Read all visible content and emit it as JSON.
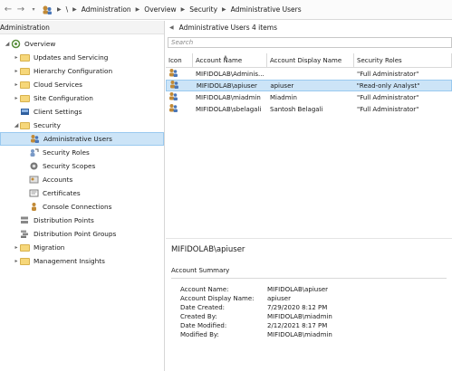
{
  "breadcrumb": {
    "items": [
      "Administration",
      "Overview",
      "Security",
      "Administrative Users"
    ]
  },
  "left_pane": {
    "title": "Administration",
    "items": [
      {
        "label": "Overview",
        "indent": 0,
        "arrow": "◢",
        "icon": "overview"
      },
      {
        "label": "Updates and Servicing",
        "indent": 1,
        "arrow": "▸",
        "icon": "folder"
      },
      {
        "label": "Hierarchy Configuration",
        "indent": 1,
        "arrow": "▸",
        "icon": "folder"
      },
      {
        "label": "Cloud Services",
        "indent": 1,
        "arrow": "▸",
        "icon": "folder"
      },
      {
        "label": "Site Configuration",
        "indent": 1,
        "arrow": "▸",
        "icon": "folder"
      },
      {
        "label": "Client Settings",
        "indent": 1,
        "arrow": "",
        "icon": "settings"
      },
      {
        "label": "Security",
        "indent": 1,
        "arrow": "◢",
        "icon": "folder"
      },
      {
        "label": "Administrative Users",
        "indent": 2,
        "arrow": "",
        "icon": "user",
        "selected": true
      },
      {
        "label": "Security Roles",
        "indent": 2,
        "arrow": "",
        "icon": "roles"
      },
      {
        "label": "Security Scopes",
        "indent": 2,
        "arrow": "",
        "icon": "scopes"
      },
      {
        "label": "Accounts",
        "indent": 2,
        "arrow": "",
        "icon": "accounts"
      },
      {
        "label": "Certificates",
        "indent": 2,
        "arrow": "",
        "icon": "cert"
      },
      {
        "label": "Console Connections",
        "indent": 2,
        "arrow": "",
        "icon": "connections"
      },
      {
        "label": "Distribution Points",
        "indent": 1,
        "arrow": "",
        "icon": "dp"
      },
      {
        "label": "Distribution Point Groups",
        "indent": 1,
        "arrow": "",
        "icon": "dpg"
      },
      {
        "label": "Migration",
        "indent": 1,
        "arrow": "▸",
        "icon": "folder"
      },
      {
        "label": "Management Insights",
        "indent": 1,
        "arrow": "▸",
        "icon": "folder"
      }
    ]
  },
  "right_pane": {
    "title": "Administrative Users 4 items",
    "search_placeholder": "Search",
    "columns": [
      "Icon",
      "Account Name",
      "Account Display Name",
      "Security Roles"
    ],
    "rows": [
      {
        "account": "MIFIDOLAB\\Adminis...",
        "display": "",
        "roles": "\"Full Administrator\""
      },
      {
        "account": "MIFIDOLAB\\apiuser",
        "display": "apiuser",
        "roles": "\"Read-only Analyst\"",
        "selected": true
      },
      {
        "account": "MIFIDOLAB\\miadmin",
        "display": "Miadmin",
        "roles": "\"Full Administrator\""
      },
      {
        "account": "MIFIDOLAB\\sbelagali",
        "display": "Santosh Belagali",
        "roles": "\"Full Administrator\""
      }
    ]
  },
  "details": {
    "title": "MIFIDOLAB\\apiuser",
    "section": "Account Summary",
    "fields": [
      {
        "label": "Account Name:",
        "value": "MIFIDOLAB\\apiuser"
      },
      {
        "label": "Account Display Name:",
        "value": "apiuser"
      },
      {
        "label": "Date Created:",
        "value": "7/29/2020 8:12 PM"
      },
      {
        "label": "Created By:",
        "value": "MIFIDOLAB\\miadmin"
      },
      {
        "label": "Date Modified:",
        "value": "2/12/2021 8:17 PM"
      },
      {
        "label": "Modified By:",
        "value": "MIFIDOLAB\\miadmin"
      }
    ]
  },
  "colors": {
    "selection": "#cce4f7",
    "selection_border": "#99c9ef",
    "folder": "#f6d77a"
  }
}
